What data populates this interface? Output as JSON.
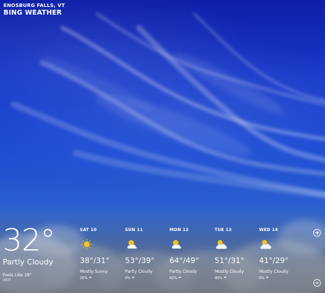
{
  "header": {
    "location": "ENOSBURG FALLS, VT",
    "app_title": "BING WEATHER"
  },
  "current": {
    "temperature": "32°",
    "condition": "Partly Cloudy",
    "feels_like": "Feels Like 28°",
    "source": "WDT"
  },
  "forecast": [
    {
      "day": "SAT 10",
      "hilo": "38°/31°",
      "condition": "Mostly Sunny",
      "precip": "20% ☂",
      "icon": "sun-icon"
    },
    {
      "day": "SUN 11",
      "hilo": "53°/39°",
      "condition": "Partly Cloudy",
      "precip": "0% ☂",
      "icon": "partly-cloudy-icon"
    },
    {
      "day": "MON 12",
      "hilo": "64°/49°",
      "condition": "Partly Cloudy",
      "precip": "60% ☂",
      "icon": "partly-cloudy-icon"
    },
    {
      "day": "TUE 13",
      "hilo": "51°/31°",
      "condition": "Mostly Cloudy",
      "precip": "40% ☂",
      "icon": "mostly-cloudy-icon"
    },
    {
      "day": "WED 14",
      "hilo": "41°/29°",
      "condition": "Mostly Cloudy",
      "precip": "0% ☂",
      "icon": "mostly-cloudy-icon"
    }
  ],
  "controls": {
    "next_icon": "arrow-right-icon",
    "expand_icon": "chevron-down-icon"
  },
  "colors": {
    "sky_top": "#0e1fa8",
    "sky_mid": "#1a49d3",
    "sun": "#f6c21a",
    "text": "#ffffff"
  }
}
